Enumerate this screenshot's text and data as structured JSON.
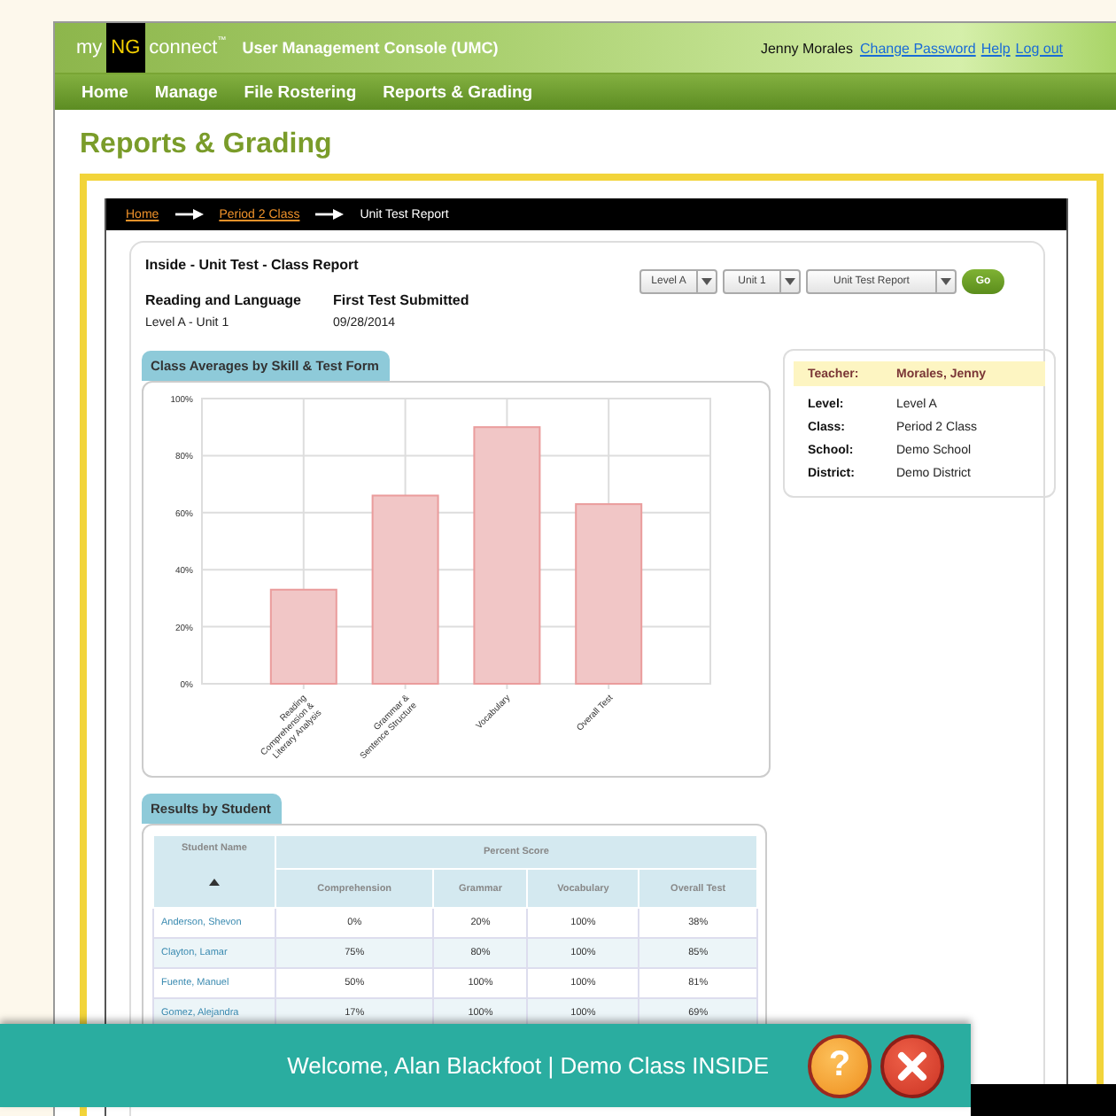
{
  "header": {
    "logo": {
      "my": "my",
      "ng": "NG",
      "connect": "connect",
      "tm": "™"
    },
    "title": "User Management Console (UMC)",
    "user": "Jenny Morales",
    "links": [
      "Change Password",
      "Help",
      "Log out"
    ]
  },
  "nav": [
    "Home",
    "Manage",
    "File Rostering",
    "Reports & Grading"
  ],
  "page_title": "Reports & Grading",
  "breadcrumb": [
    {
      "label": "Home",
      "kind": "link"
    },
    {
      "label": "Period 2 Class",
      "kind": "link"
    },
    {
      "label": "Unit Test Report",
      "kind": "current"
    }
  ],
  "report": {
    "title": "Inside - Unit Test - Class Report",
    "program_label": "Reading and Language",
    "program_value": "Level A - Unit 1",
    "submitted_label": "First Test Submitted",
    "submitted_value": "09/28/2014"
  },
  "filters": {
    "selects": [
      "Level A",
      "Unit 1",
      "Unit Test Report"
    ],
    "go": "Go"
  },
  "chart_section": {
    "title": "Class Averages by Skill & Test Form",
    "chart_data": {
      "type": "bar",
      "grid": true,
      "categories": [
        "Reading Comprehension & Literary Analysis",
        "Grammar & Sentence Structure",
        "Vocabulary",
        "Overall Test"
      ],
      "values": [
        33,
        66,
        90,
        63
      ],
      "ylim": [
        0,
        100
      ],
      "yticks": [
        {
          "value": 0,
          "label": "0%"
        },
        {
          "value": 20,
          "label": "20%"
        },
        {
          "value": 40,
          "label": "40%"
        },
        {
          "value": 60,
          "label": "60%"
        },
        {
          "value": 80,
          "label": "80%"
        },
        {
          "value": 100,
          "label": "100%"
        }
      ]
    }
  },
  "teacher_card": {
    "label": "Teacher:",
    "value": "Morales, Jenny",
    "rows": [
      {
        "label": "Level:",
        "value": "Level A"
      },
      {
        "label": "Class:",
        "value": "Period 2 Class"
      },
      {
        "label": "School:",
        "value": "Demo School"
      },
      {
        "label": "District:",
        "value": "Demo District"
      }
    ]
  },
  "results": {
    "title": "Results by Student",
    "name_header": "Student Name",
    "group_header": "Percent Score",
    "columns": [
      "Comprehension",
      "Grammar",
      "Vocabulary",
      "Overall Test"
    ],
    "rows": [
      {
        "name": "Anderson, Shevon",
        "cells": [
          "0%",
          "20%",
          "100%",
          "38%"
        ]
      },
      {
        "name": "Clayton, Lamar",
        "cells": [
          "75%",
          "80%",
          "100%",
          "85%"
        ]
      },
      {
        "name": "Fuente, Manuel",
        "cells": [
          "50%",
          "100%",
          "100%",
          "81%"
        ]
      },
      {
        "name": "Gomez, Alejandra",
        "cells": [
          "17%",
          "100%",
          "100%",
          "69%"
        ]
      }
    ]
  },
  "welcome_bar": {
    "text": "Welcome, Alan Blackfoot | Demo Class INSIDE",
    "help": "?"
  }
}
